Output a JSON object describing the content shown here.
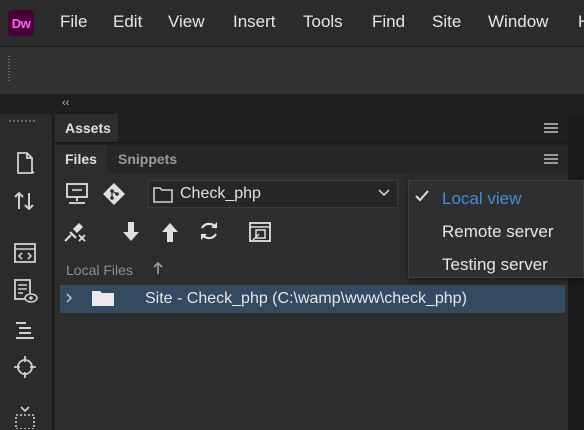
{
  "app": {
    "logo_text": "Dw",
    "logo_bg": "#470137",
    "logo_fg": "#ff61f6"
  },
  "menu": {
    "items": [
      "File",
      "Edit",
      "View",
      "Insert",
      "Tools",
      "Find",
      "Site",
      "Window",
      "H"
    ]
  },
  "leftbar": {
    "icons": [
      "new-file-icon",
      "get-put-icon",
      "code-view-icon",
      "live-view-icon",
      "format-source-icon",
      "target-icon",
      "select-region-icon"
    ]
  },
  "panel": {
    "assets_tab": "Assets",
    "files_tab": "Files",
    "snippets_tab": "Snippets",
    "site_name": "Check_php",
    "local_files_label": "Local Files",
    "file_row_label": "Site - Check_php (C:\\wamp\\www\\check_php)"
  },
  "view_menu": {
    "items": [
      {
        "label": "Local view",
        "checked": true
      },
      {
        "label": "Remote server",
        "checked": false
      },
      {
        "label": "Testing server",
        "checked": false
      }
    ]
  },
  "colors": {
    "accent": "#3d8fdc",
    "selection": "#334a61"
  }
}
